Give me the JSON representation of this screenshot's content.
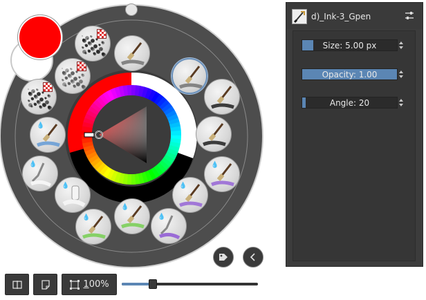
{
  "palette": {
    "foreground_color": "#ff0000",
    "background_color": "#ffffff",
    "hue_ring_colors": [
      "#ff0000",
      "#ffff00",
      "#00ff00",
      "#00ffff",
      "#0000ff",
      "#ff00ff",
      "#ff0000"
    ],
    "presets": [
      {
        "name": "preset-texture-spray",
        "icon": "spray-texture-icon",
        "selected": false
      },
      {
        "name": "preset-brush-soft-gray",
        "icon": "paint-brush-icon",
        "selected": false
      },
      {
        "name": "preset-ink-gpen",
        "icon": "ink-pen-icon",
        "selected": true
      },
      {
        "name": "preset-bristle-brush",
        "icon": "bristle-brush-icon",
        "selected": false
      },
      {
        "name": "preset-bristle-dots",
        "icon": "bristle-brush-icon",
        "selected": false
      },
      {
        "name": "preset-wet-purple",
        "icon": "wet-brush-icon",
        "selected": false
      },
      {
        "name": "preset-fan-purple",
        "icon": "fan-brush-icon",
        "selected": false
      },
      {
        "name": "preset-palette-knife-purple",
        "icon": "palette-knife-icon",
        "selected": false
      },
      {
        "name": "preset-blender-green",
        "icon": "blender-brush-icon",
        "selected": false
      },
      {
        "name": "preset-round-green",
        "icon": "round-brush-icon",
        "selected": false
      },
      {
        "name": "preset-tube-white",
        "icon": "paint-tube-icon",
        "selected": false
      },
      {
        "name": "preset-palette-knife-white",
        "icon": "palette-knife-icon",
        "selected": false
      },
      {
        "name": "preset-wet-blue",
        "icon": "wet-brush-icon",
        "selected": false
      },
      {
        "name": "preset-texture-dark",
        "icon": "spray-texture-icon",
        "selected": false
      },
      {
        "name": "preset-texture-light",
        "icon": "spray-texture-icon",
        "selected": false
      }
    ]
  },
  "brush_settings": {
    "preset_name": "d)_Ink-3_Gpen",
    "size": {
      "label": "Size: 5.00 px",
      "fraction": 0.12
    },
    "opacity": {
      "label": "Opacity: 1.00",
      "fraction": 1.0
    },
    "angle": {
      "label": "Angle: 20",
      "fraction": 0.04
    }
  },
  "toolbar": {
    "zoom_prefix": "",
    "zoom_underlined": "1",
    "zoom_rest": "00%",
    "zoom_slider_fraction": 0.23
  }
}
